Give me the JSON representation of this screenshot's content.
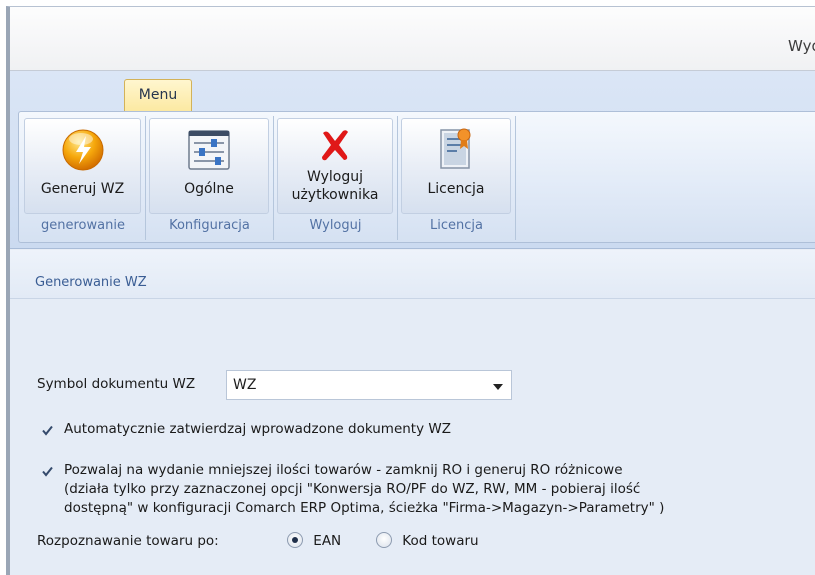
{
  "window": {
    "title": "Wyd"
  },
  "ribbon": {
    "menu_tab": "Menu",
    "groups": [
      {
        "button": "Generuj WZ",
        "label": "generowanie",
        "icon": "lightning-icon"
      },
      {
        "button": "Ogólne",
        "label": "Konfiguracja",
        "icon": "settings-sliders-icon"
      },
      {
        "button_line1": "Wyloguj",
        "button_line2": "użytkownika",
        "label": "Wyloguj",
        "icon": "red-x-icon"
      },
      {
        "button": "Licencja",
        "label": "Licencja",
        "icon": "certificate-icon"
      }
    ]
  },
  "section": {
    "title": "Generowanie WZ"
  },
  "form": {
    "symbol_label": "Symbol dokumentu WZ",
    "symbol_value": "WZ",
    "auto_approve": {
      "checked": true,
      "label": "Automatycznie zatwierdzaj wprowadzone dokumenty WZ"
    },
    "allow_less": {
      "checked": true,
      "line1": "Pozwalaj na wydanie mniejszej ilości towarów - zamknij RO i generuj RO różnicowe",
      "line2": "(działa tylko przy zaznaczonej opcji \"Konwersja RO/PF do WZ, RW, MM - pobieraj ilość",
      "line3": "dostępną\" w konfiguracji Comarch ERP Optima, ścieżka \"Firma->Magazyn->Parametry\" )"
    },
    "recognition_label": "Rozpoznawanie towaru po:",
    "recognition_options": [
      {
        "label": "EAN",
        "selected": true
      },
      {
        "label": "Kod towaru",
        "selected": false
      }
    ]
  },
  "colors": {
    "accent": "#5372a4",
    "tab_active": "#fce9a2",
    "ribbon_bg": "#d5e1f2"
  }
}
